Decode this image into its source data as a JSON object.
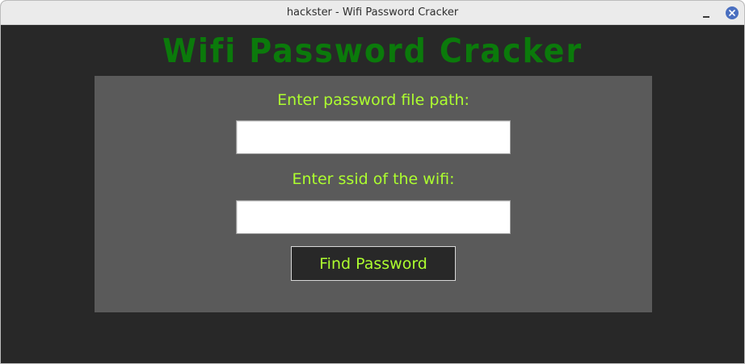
{
  "window": {
    "title": "hackster - Wifi Password Cracker"
  },
  "app": {
    "title": "Wifi Password Cracker"
  },
  "form": {
    "path_label": "Enter password file path:",
    "path_value": "",
    "ssid_label": "Enter ssid of the wifi:",
    "ssid_value": "",
    "submit_label": "Find Password"
  },
  "icons": {
    "minimize": "minimize-icon",
    "close": "close-icon"
  },
  "colors": {
    "background": "#282828",
    "panel": "#5a5a5a",
    "title_green": "#0b7a0b",
    "label_green": "#adff2f",
    "close_button": "#4a6fc0"
  }
}
